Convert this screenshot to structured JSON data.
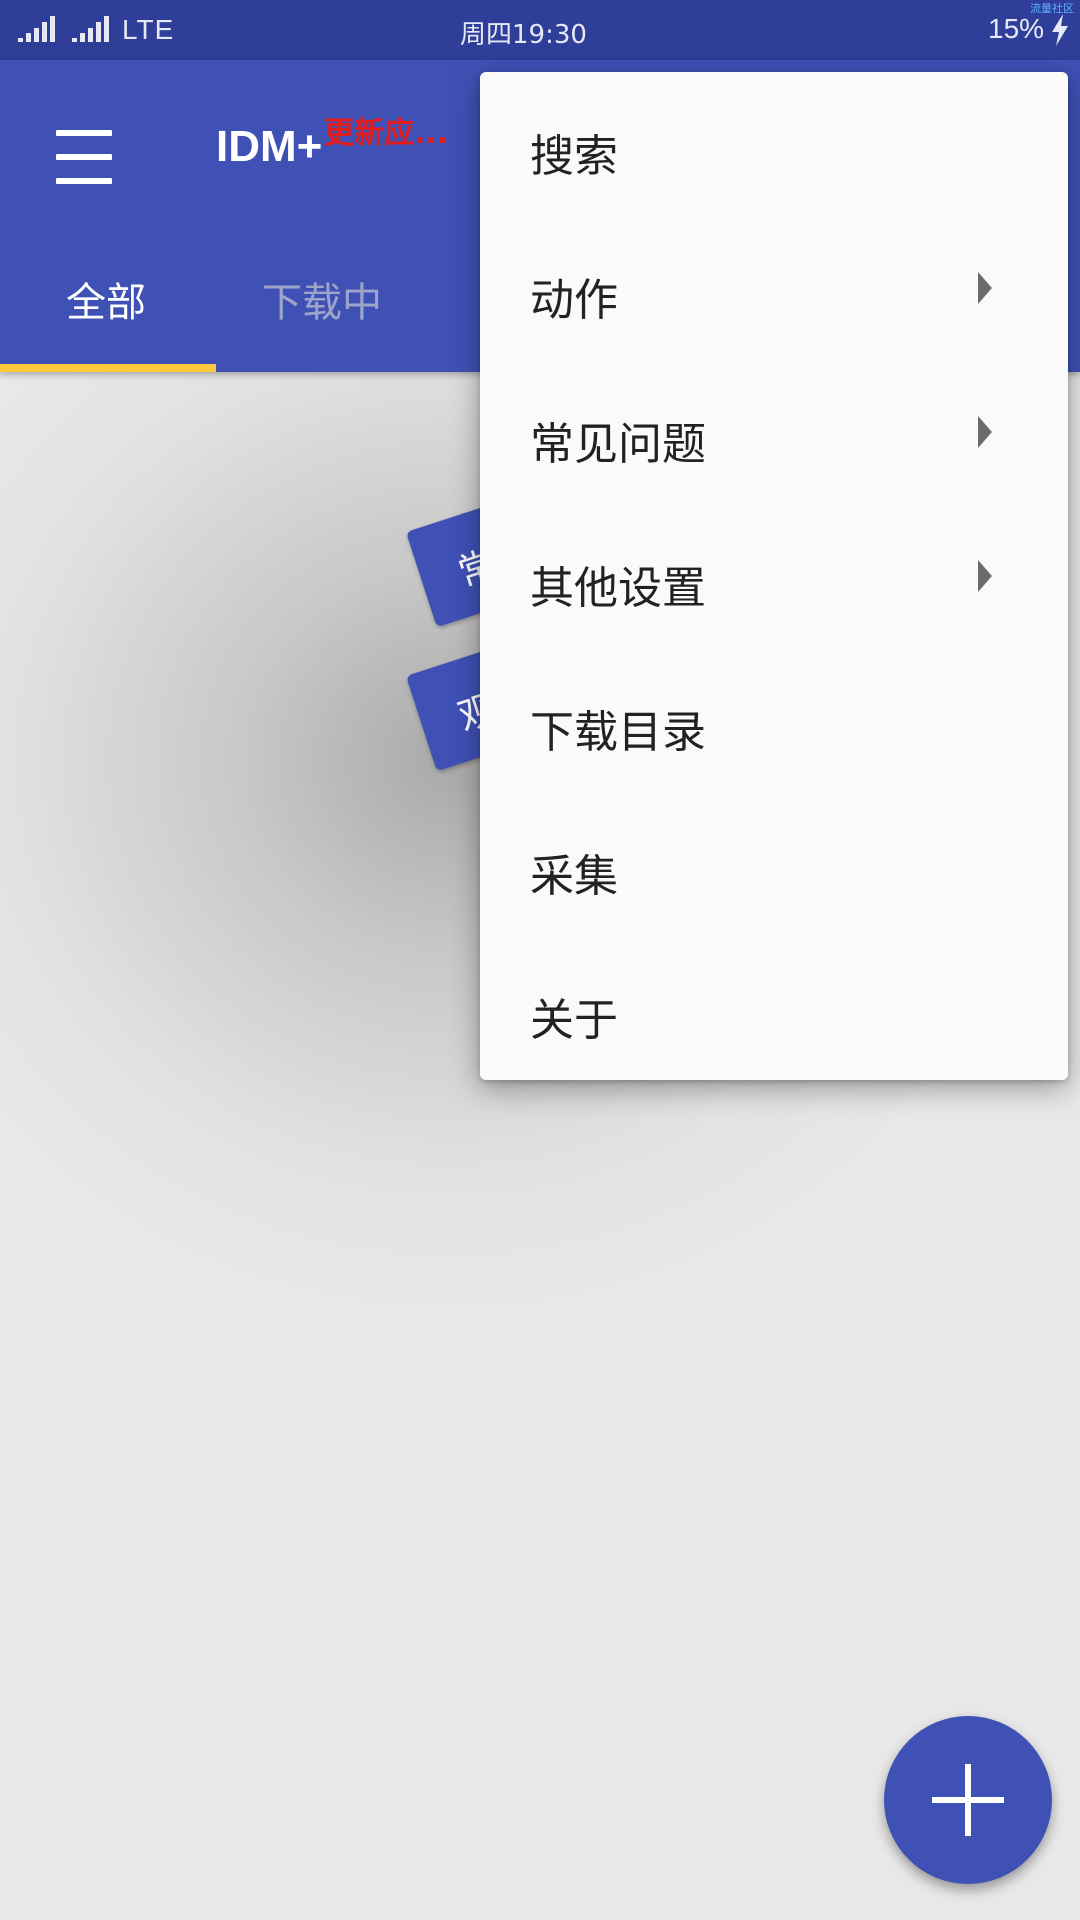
{
  "status_bar": {
    "network_type": "LTE",
    "clock": "周四19:30",
    "battery": "15%",
    "watermark": "流量社区",
    "icons": [
      "signal-icon",
      "signal-icon",
      "charging-bolt-icon"
    ]
  },
  "app_bar": {
    "title": "IDM+",
    "update_badge": "更新应...",
    "menu_icon": "hamburger-menu-icon",
    "tabs": [
      {
        "label": "全部",
        "selected": true
      },
      {
        "label": "下载中",
        "selected": false
      }
    ]
  },
  "background_cards": [
    {
      "label": "常"
    },
    {
      "label": "观"
    }
  ],
  "overflow_menu": {
    "items": [
      {
        "label": "搜索",
        "has_submenu": false
      },
      {
        "label": "动作",
        "has_submenu": true
      },
      {
        "label": "常见问题",
        "has_submenu": true
      },
      {
        "label": "其他设置",
        "has_submenu": true
      },
      {
        "label": "下载目录",
        "has_submenu": false
      },
      {
        "label": "采集",
        "has_submenu": false
      },
      {
        "label": "关于",
        "has_submenu": false
      }
    ]
  },
  "fab": {
    "icon": "plus-icon"
  },
  "colors": {
    "primary": "#3f51b5",
    "status_bar": "#2f3e99",
    "tab_indicator": "#ffc93c",
    "update_badge": "#e21b1b",
    "menu_background": "#fafafa"
  }
}
